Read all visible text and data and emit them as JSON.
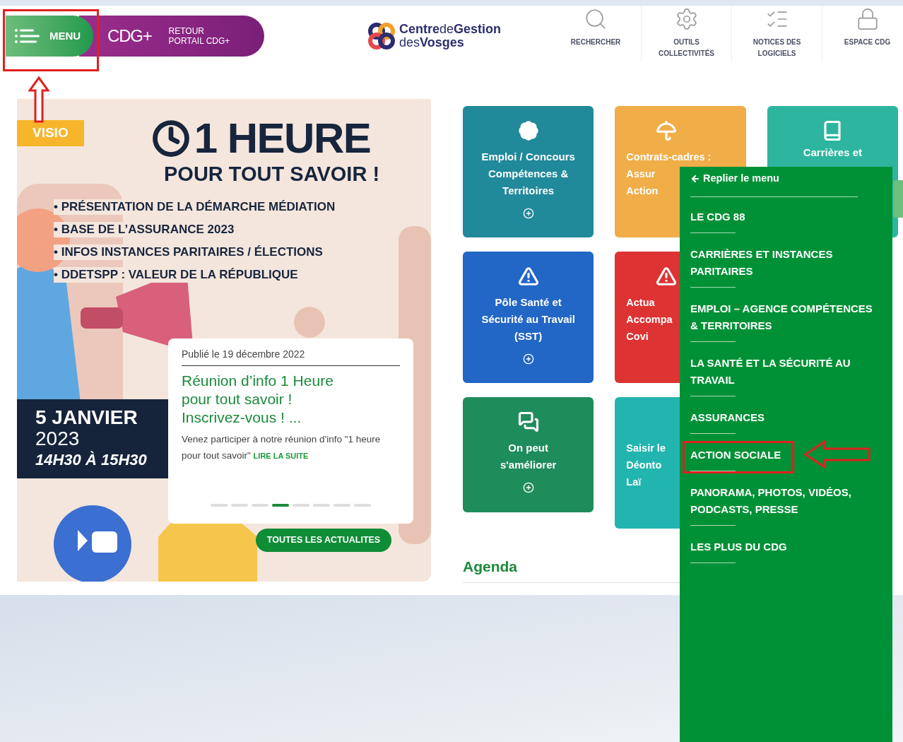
{
  "header": {
    "menu_button": {
      "label": "MENU",
      "annotated": true
    },
    "portal_link": {
      "logo": "CDG+",
      "label": "RETOUR PORTAIL CDG+"
    },
    "logo": {
      "line1": "**Centre**de**Gestion**",
      "line2": "des**Vosges**"
    },
    "tools": [
      {
        "kind": "search",
        "label": "RECHERCHER"
      },
      {
        "kind": "gear",
        "label": "OUTILS COLLECTIVITÉS"
      },
      {
        "kind": "list",
        "label": "NOTICES DES LOGICIELS"
      },
      {
        "kind": "lock",
        "label": "ESPACE CDG"
      }
    ]
  },
  "banner": {
    "badge": "VISIO",
    "title": "1 HEURE",
    "subtitle": "POUR TOUT SAVOIR !",
    "bullets": [
      "• PRÉSENTATION DE LA DÉMARCHE MÉDIATION",
      "• BASE DE L’ASSURANCE 2023",
      "• INFOS INSTANCES PARITAIRES / ÉLECTIONS",
      "• DDETSPP : VALEUR DE LA RÉPUBLIQUE"
    ],
    "date": "5 JANVIER",
    "year": "2023",
    "time": "14H30 À 15H30"
  },
  "news": {
    "date": "Publié le 19 décembre 2022",
    "title": "Réunion d’info 1 Heure pour tout savoir ! Inscrivez-vous ! ...",
    "excerpt": "Venez participer à notre réunion d'info \"1 heure pour tout savoir\"",
    "link": "LIRE LA SUITE",
    "dots": [
      {
        "selected": false
      },
      {
        "selected": false
      },
      {
        "selected": false
      },
      {
        "selected": true
      },
      {
        "selected": false
      },
      {
        "selected": false
      },
      {
        "selected": false
      },
      {
        "selected": false
      }
    ],
    "all_button": "TOUTES LES ACTUALITES"
  },
  "card_rows": [
    [
      {
        "kind": "badge",
        "color": "#20899a",
        "lines": [
          "Emploi / Concours",
          "Compétences &",
          "Territoires"
        ]
      },
      {
        "kind": "umbrella",
        "color": "#f0ad48",
        "lines": [
          "Contrats-cadres :",
          "Assur",
          "Action"
        ]
      },
      {
        "kind": "book",
        "color": "#2db5a0",
        "lines": [
          "Carrières et"
        ]
      }
    ],
    [
      {
        "kind": "warning",
        "color": "#2266c6",
        "lines": [
          "Pôle Santé et",
          "Sécurité au Travail",
          "(SST)"
        ]
      },
      {
        "kind": "warning",
        "color": "#dd3333",
        "lines": [
          "Actua",
          "Accompa",
          "Covi"
        ]
      }
    ],
    [
      {
        "kind": "chat",
        "color": "#1f8c5c",
        "lines": [
          "On peut",
          "s'améliorer"
        ]
      },
      {
        "kind": "plain",
        "color": "#22b5b0",
        "lines": [
          "Saisir le",
          "Déonto",
          "Laï"
        ]
      }
    ]
  ],
  "agenda": {
    "title": "Agenda"
  },
  "side_menu": {
    "back": "Replier le menu",
    "items": [
      {
        "label": "LE CDG 88",
        "annotated": false
      },
      {
        "label": "CARRIÈRES ET INSTANCES PARITAIRES",
        "annotated": false
      },
      {
        "label": "EMPLOI – AGENCE COMPÉTENCES & TERRITOIRES",
        "annotated": false
      },
      {
        "label": "LA SANTÉ ET LA SÉCURITÉ AU TRAVAIL",
        "annotated": false
      },
      {
        "label": "ASSURANCES",
        "annotated": false
      },
      {
        "label": "ACTION SOCIALE",
        "annotated": true
      },
      {
        "label": "PANORAMA, PHOTOS, VIDÉOS, PODCASTS, PRESSE",
        "annotated": false
      },
      {
        "label": "LES PLUS DU CDG",
        "annotated": false
      }
    ]
  }
}
